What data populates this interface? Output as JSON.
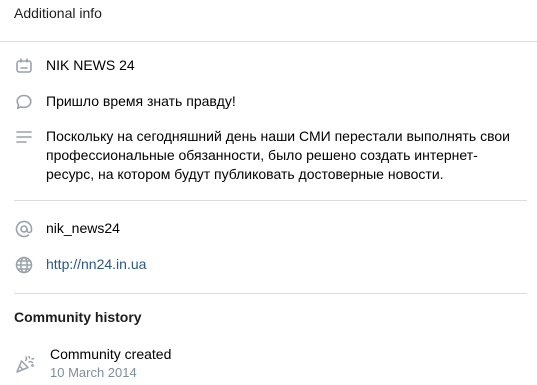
{
  "header": {
    "title": "Additional info"
  },
  "info": {
    "name": "NIK NEWS 24",
    "status": "Пришло время знать правду!",
    "description": "Поскольку на сегодняшний день  наши СМИ перестали выполнять свои профессиональные обязанности, было решено создать интернет-ресурс, на котором будут публиковать достоверные новости.",
    "username": "nik_news24",
    "website": "http://nn24.in.ua"
  },
  "history": {
    "title": "Community history",
    "event_label": "Community created",
    "event_date": "10 March 2014"
  },
  "icons": {
    "name": "calendar-badge-icon",
    "status": "speech-bubble-icon",
    "description": "text-lines-icon",
    "username": "at-sign-icon",
    "website": "globe-icon",
    "history": "party-popper-icon"
  },
  "colors": {
    "icon": "#99a2ad",
    "link": "#2a5885",
    "secondary_text": "#818c99",
    "divider": "#dcdcdc"
  }
}
